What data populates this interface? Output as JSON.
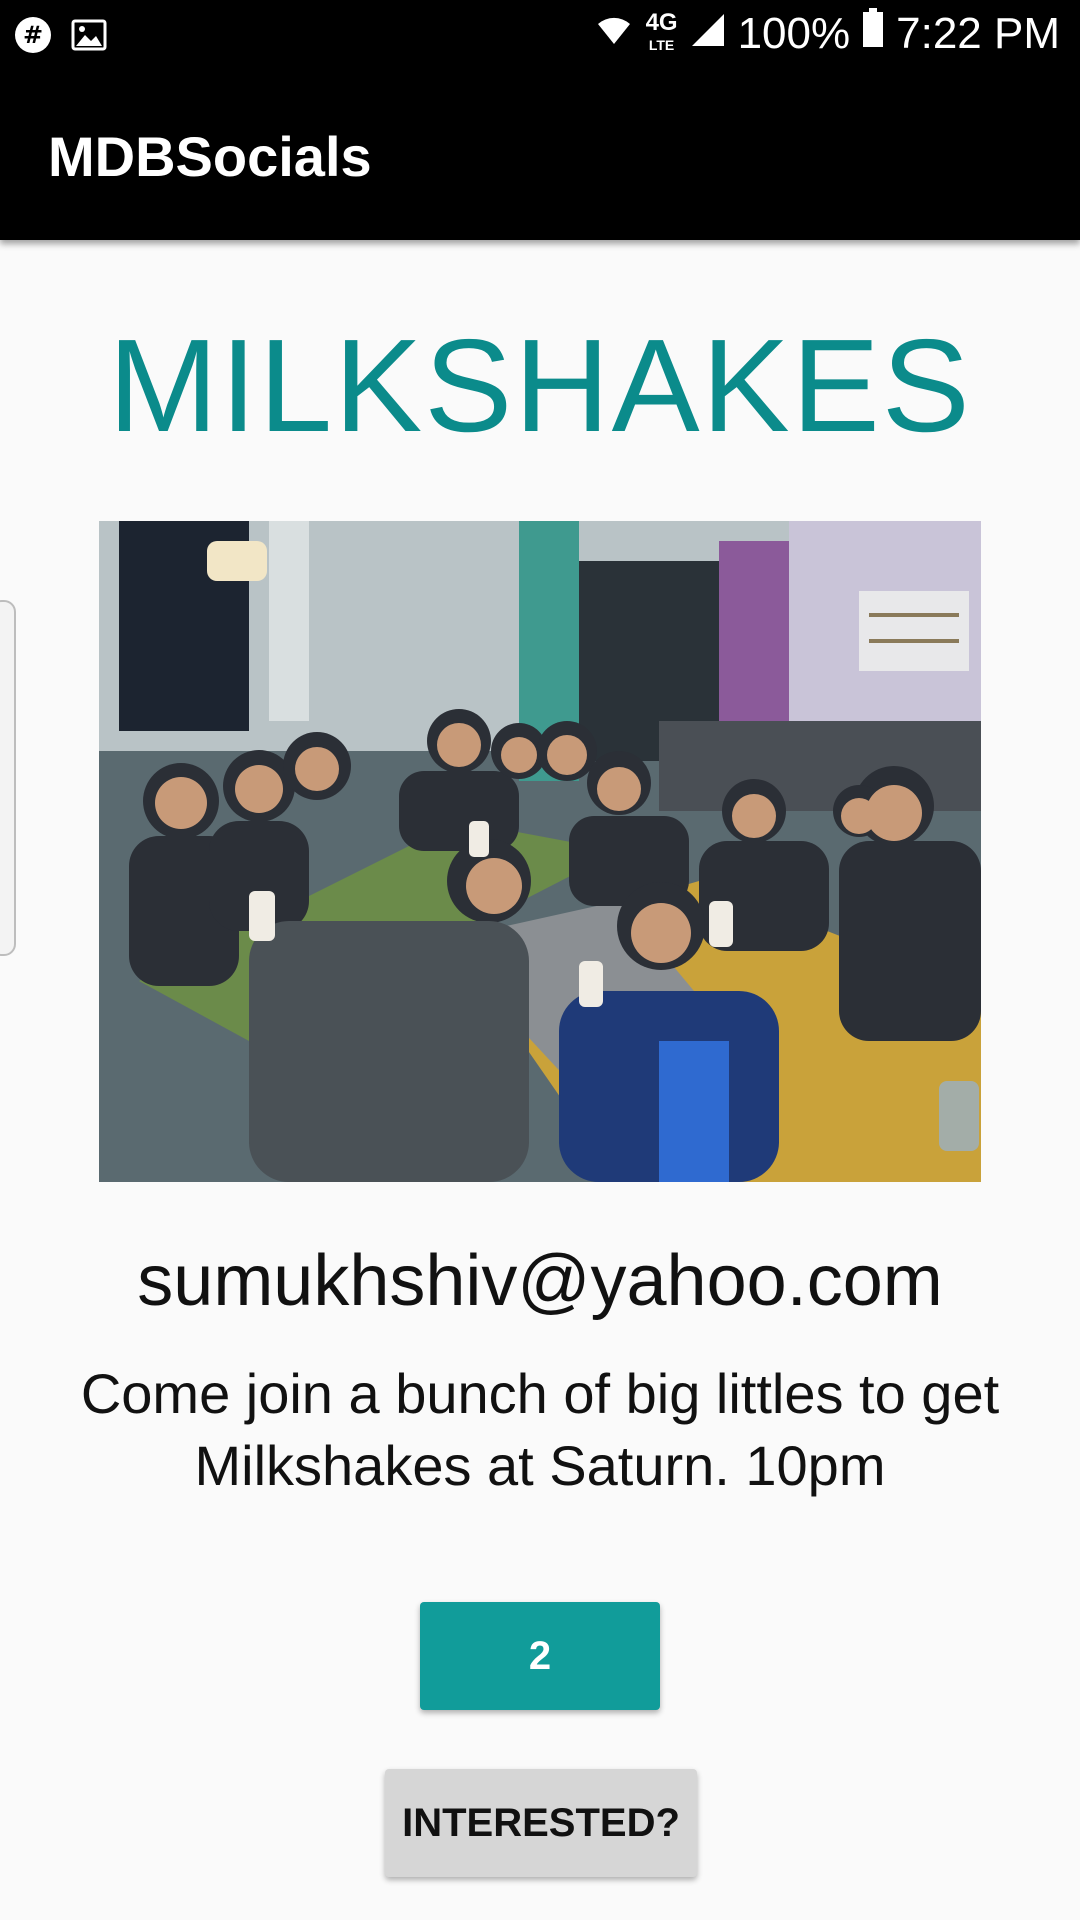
{
  "status_bar": {
    "network": "4G",
    "network_sub": "LTE",
    "battery": "100%",
    "time": "7:22 PM",
    "icons": [
      "slack-icon",
      "image-icon",
      "wifi-icon",
      "lte-icon",
      "signal-icon",
      "battery-icon"
    ]
  },
  "app_bar": {
    "title": "MDBSocials"
  },
  "event": {
    "title": "MILKSHAKES",
    "image_alt": "Group photo at restaurant",
    "email": "sumukhshiv@yahoo.com",
    "description": "Come join a bunch of big littles to get Milkshakes at Saturn. 10pm",
    "interested_count": "2",
    "interested_label": "INTERESTED?"
  },
  "colors": {
    "accent": "#0b8b8b",
    "count_button": "#119c9a",
    "interested_button": "#d6d6d6",
    "app_bar": "#000000"
  }
}
